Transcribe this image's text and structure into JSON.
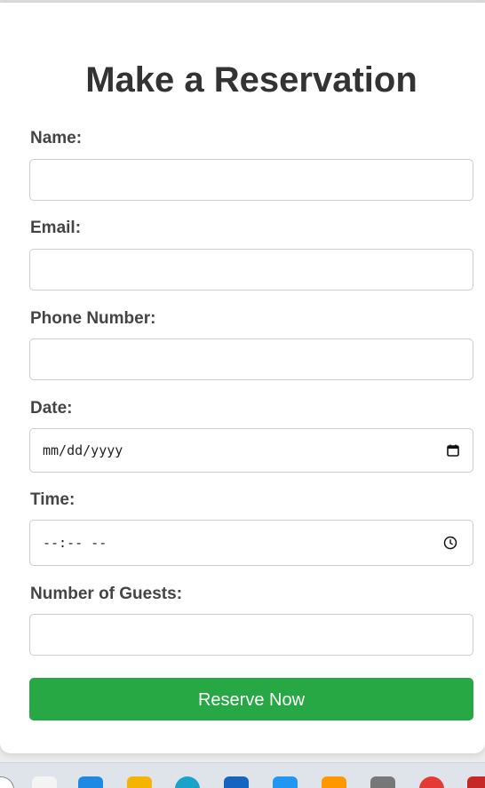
{
  "page": {
    "title": "Make a Reservation"
  },
  "form": {
    "name_label": "Name:",
    "email_label": "Email:",
    "phone_label": "Phone Number:",
    "date_label": "Date:",
    "date_placeholder": "mm/dd/yyyy",
    "time_label": "Time:",
    "time_placeholder": "--:-- --",
    "guests_label": "Number of Guests:",
    "submit_label": "Reserve Now"
  },
  "colors": {
    "button": "#28a745",
    "title": "#333333",
    "label": "#444444"
  },
  "taskbar": {
    "icons": [
      "search-icon",
      "file-explorer-icon",
      "folder-icon",
      "edge-icon",
      "store-icon",
      "app-icon",
      "photos-icon",
      "camera-icon",
      "chrome-icon",
      "app-icon"
    ]
  }
}
